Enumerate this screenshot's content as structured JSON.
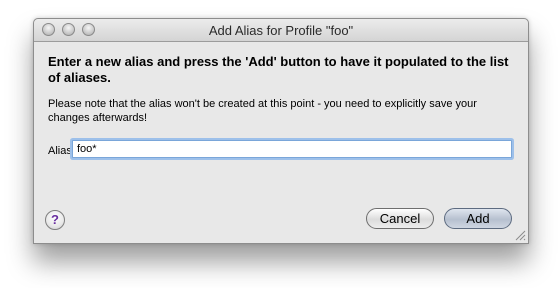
{
  "window": {
    "title": "Add Alias for Profile \"foo\""
  },
  "dialog": {
    "heading": "Enter a new alias and press the 'Add' button to have it populated to the list of aliases.",
    "note": "Please note that the alias won't be created at this point - you need to explicitly save your changes afterwards!",
    "alias_label": "Alias:",
    "alias_value": "foo*"
  },
  "buttons": {
    "help_label": "?",
    "cancel_label": "Cancel",
    "add_label": "Add"
  },
  "colors": {
    "window_bg": "#e8e8e8",
    "focus_ring": "#9dc0ea",
    "help_glyph": "#6a2fa0"
  },
  "icons": {
    "close": "close-icon",
    "minimize": "minimize-icon",
    "zoom": "zoom-icon",
    "help": "help-icon",
    "resize": "resize-grip-icon"
  }
}
